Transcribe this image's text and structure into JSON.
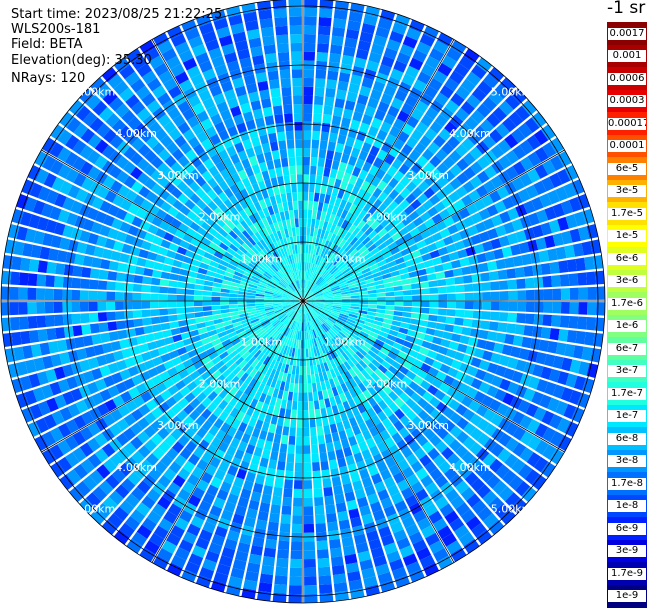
{
  "header": {
    "start_time": "Start time: 2023/08/25 21:22:25",
    "instrument": "WLS200s-181",
    "field": "Field: BETA",
    "elevation": "Elevation(deg): 35.30",
    "nrays": "NRays: 120"
  },
  "range_rings": {
    "labels": [
      "1.00km",
      "2.00km",
      "3.00km",
      "4.00km",
      "5.00km"
    ],
    "ring_values_km": [
      1,
      2,
      3,
      4,
      5
    ]
  },
  "colorbar": {
    "title": "-1 sr",
    "labels": [
      "0.0017",
      "0.001",
      "0.0006",
      "0.0003",
      "0.00017",
      "0.0001",
      "6e-5",
      "3e-5",
      "1.7e-5",
      "1e-5",
      "6e-6",
      "3e-6",
      "1.7e-6",
      "1e-6",
      "6e-7",
      "3e-7",
      "1.7e-7",
      "1e-7",
      "6e-8",
      "3e-8",
      "1.7e-8",
      "1e-8",
      "6e-9",
      "3e-9",
      "1.7e-9",
      "1e-9"
    ],
    "colors": [
      "#8b0000",
      "#a80000",
      "#c80000",
      "#e80000",
      "#ff2000",
      "#ff5000",
      "#ff8000",
      "#ffb000",
      "#ffe000",
      "#ffff00",
      "#e0ff20",
      "#c0ff40",
      "#a0ff60",
      "#80ff80",
      "#60ffa0",
      "#40ffc0",
      "#20ffe0",
      "#00e8ff",
      "#00c0ff",
      "#0098ff",
      "#0070ff",
      "#0048ff",
      "#0020ff",
      "#0000e0",
      "#0000b0",
      "#000080"
    ]
  },
  "palette_weights": {
    "colors": [
      "#00ffff",
      "#20ffe0",
      "#00e8ff",
      "#00c0ff",
      "#0098ff",
      "#0070ff",
      "#0048ff",
      "#0020ff"
    ]
  }
}
